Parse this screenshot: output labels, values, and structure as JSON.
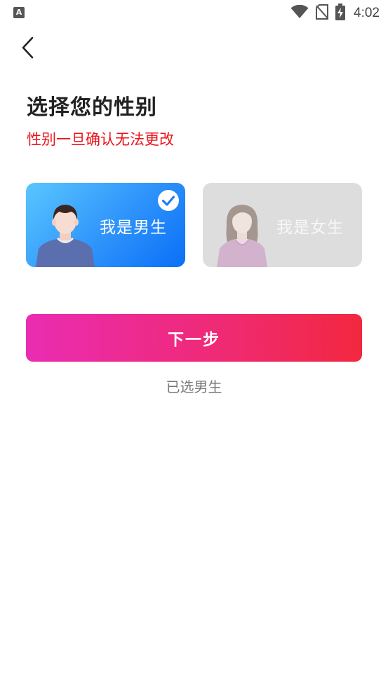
{
  "status_bar": {
    "app_icon_letter": "A",
    "time": "4:02"
  },
  "page": {
    "title": "选择您的性别",
    "warning": "性别一旦确认无法更改"
  },
  "gender_options": {
    "male": {
      "label": "我是男生",
      "selected": true
    },
    "female": {
      "label": "我是女生",
      "selected": false
    }
  },
  "next_button": {
    "label": "下一步"
  },
  "selected_hint": "已选男生",
  "colors": {
    "warning_red": "#e8141b",
    "male_card_gradient": [
      "#5ac6ff",
      "#0a6ff6"
    ],
    "female_card_bg": "#dddddd",
    "button_gradient": [
      "#ea2cb2",
      "#f2283f"
    ]
  }
}
